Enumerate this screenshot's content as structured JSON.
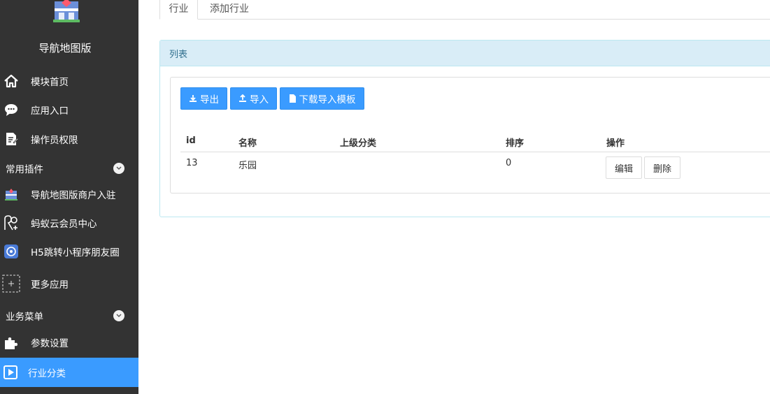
{
  "sidebar": {
    "app_name": "导航地图版",
    "items": [
      {
        "label": "模块首页",
        "icon": "home-icon"
      },
      {
        "label": "应用入口",
        "icon": "chat-bubble-icon"
      },
      {
        "label": "操作员权限",
        "icon": "document-edit-icon"
      }
    ],
    "section_plugins": "常用插件",
    "plugins": [
      {
        "label": "导航地图版商户入驻",
        "icon": "shop-icon"
      },
      {
        "label": "蚂蚁云会员中心",
        "icon": "members-icon"
      },
      {
        "label": "H5跳转小程序朋友圈",
        "icon": "mini-program-icon"
      },
      {
        "label": "更多应用",
        "icon": "plus-icon"
      }
    ],
    "section_business": "业务菜单",
    "business": [
      {
        "label": "参数设置",
        "icon": "puzzle-icon"
      },
      {
        "label": "行业分类",
        "icon": "play-square-icon",
        "active": true
      }
    ]
  },
  "tabs": [
    {
      "label": "行业",
      "active": true
    },
    {
      "label": "添加行业",
      "active": false
    }
  ],
  "panel": {
    "title": "列表",
    "buttons": {
      "export": "导出",
      "import": "导入",
      "template": "下载导入模板"
    },
    "table": {
      "columns": [
        "id",
        "名称",
        "上级分类",
        "排序",
        "操作"
      ],
      "rows": [
        {
          "id": "13",
          "name": "乐园",
          "parent": "",
          "sort": "0",
          "edit": "编辑",
          "delete": "删除"
        }
      ]
    }
  },
  "colors": {
    "sidebar_bg": "#333333",
    "accent": "#3a9bff",
    "panel_head_bg": "#d9edf7"
  }
}
